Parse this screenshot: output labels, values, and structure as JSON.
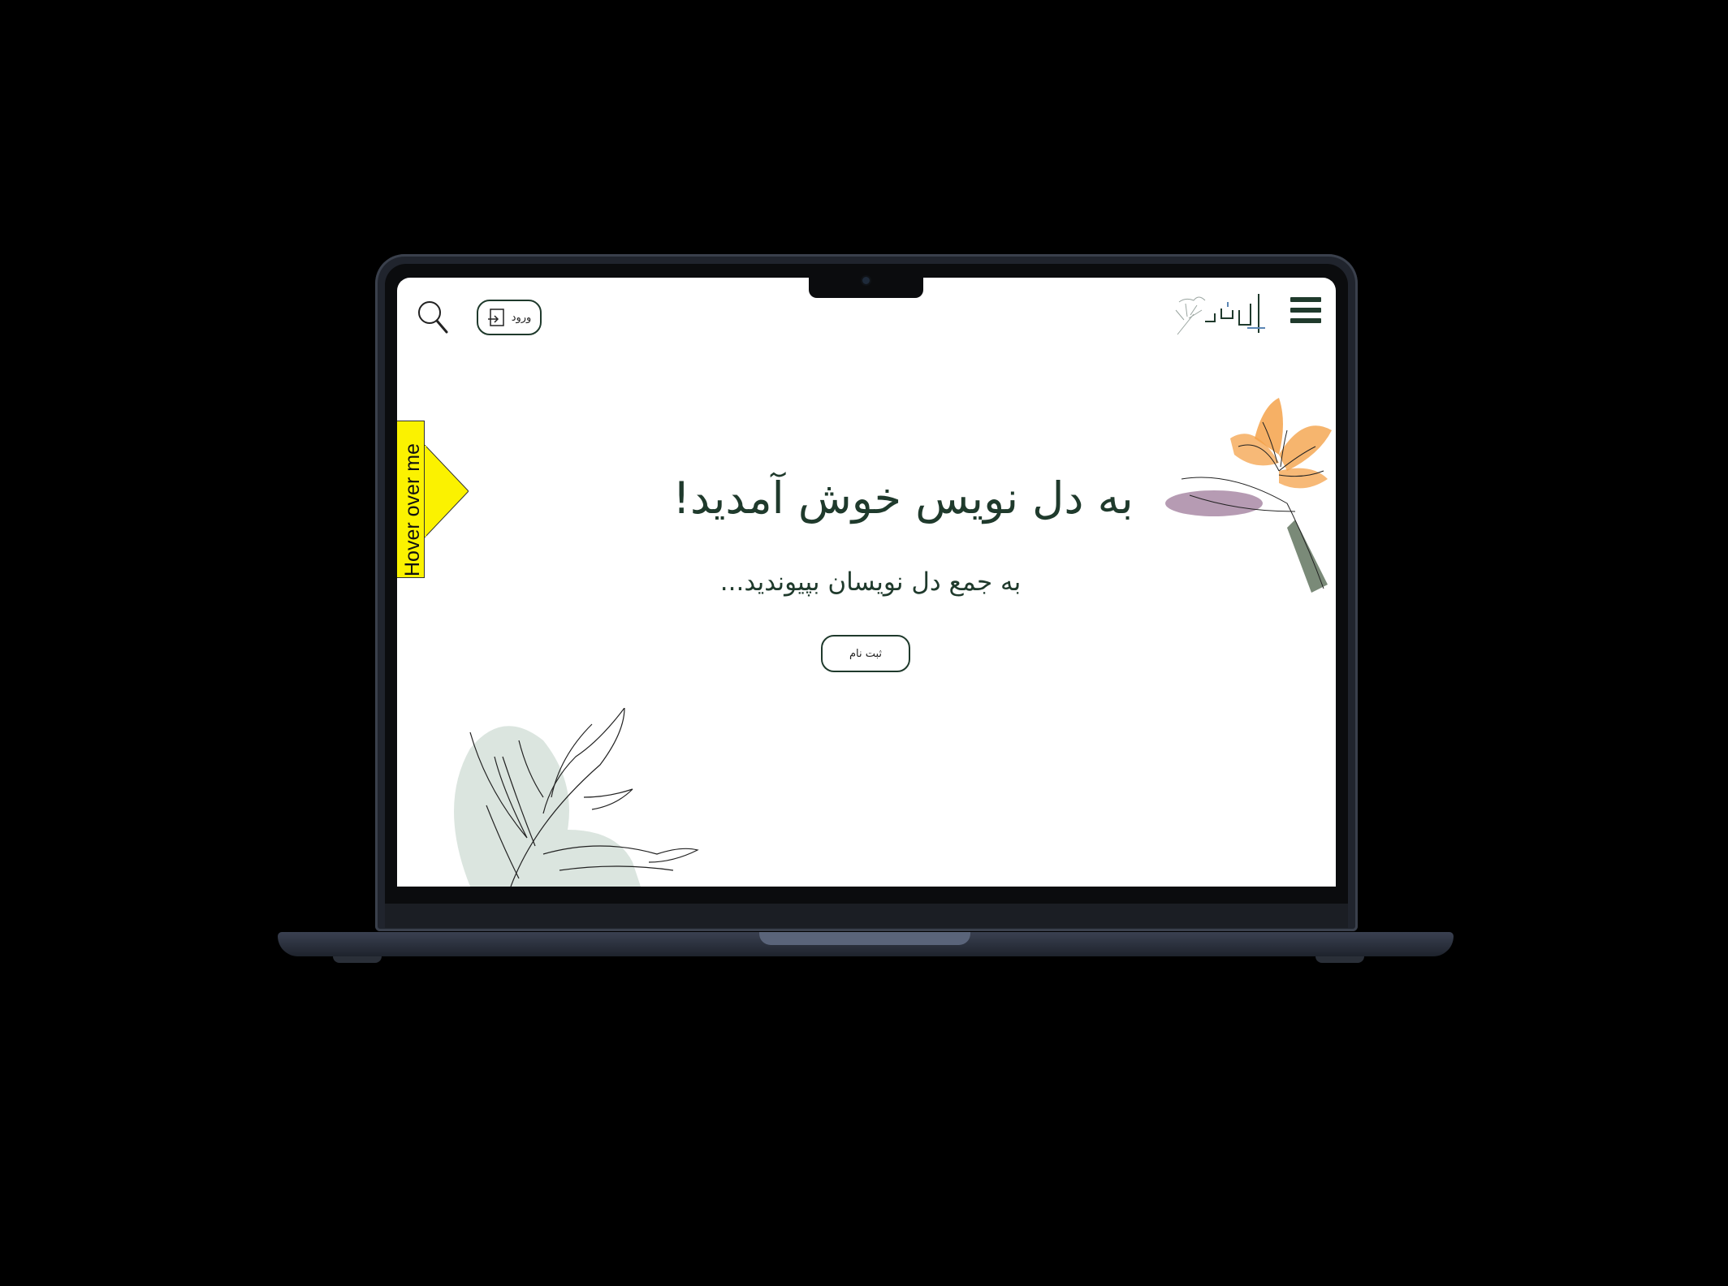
{
  "header": {
    "menu_icon": "hamburger-menu-icon",
    "logo_icon": "dil-nevis-logo-icon",
    "search_icon": "search-icon",
    "login_label": "ورود",
    "login_icon": "login-door-icon"
  },
  "hover_tab": {
    "label": "Hover over me",
    "color": "#fbf200"
  },
  "hero": {
    "title": "به دل نویس خوش آمدید!",
    "subtitle": "به جمع دل نویسان بپیوندید...",
    "signup_label": "ثبت نام"
  },
  "decorations": {
    "flower": "bird-of-paradise-flower-illustration",
    "plant": "leafy-plant-illustration"
  },
  "colors": {
    "brand_green": "#1f3a2c",
    "background": "#ffffff",
    "flower_orange": "#f4a24a",
    "flower_purple": "#a98aa6",
    "plant_sage": "#dbe5df"
  }
}
